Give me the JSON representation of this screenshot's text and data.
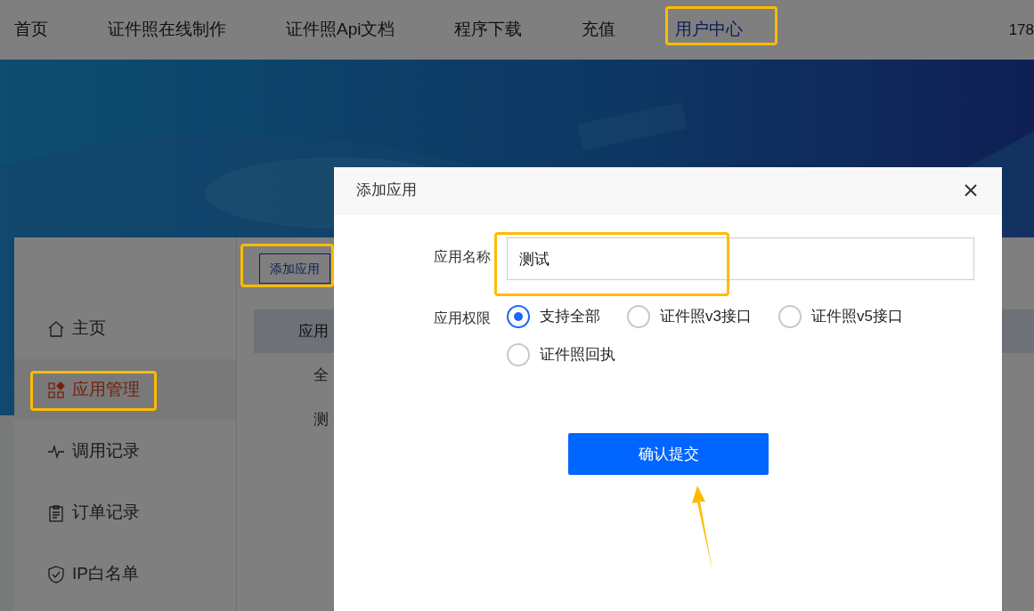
{
  "nav": {
    "items": [
      {
        "label": "首页",
        "selected": false
      },
      {
        "label": "证件照在线制作",
        "selected": false
      },
      {
        "label": "证件照Api文档",
        "selected": false
      },
      {
        "label": "程序下载",
        "selected": false
      },
      {
        "label": "充值",
        "selected": false
      },
      {
        "label": "用户中心",
        "selected": true
      }
    ],
    "user": "178"
  },
  "sidebar": {
    "items": [
      {
        "label": "主页",
        "selected": false
      },
      {
        "label": "应用管理",
        "selected": true
      },
      {
        "label": "调用记录",
        "selected": false
      },
      {
        "label": "订单记录",
        "selected": false
      },
      {
        "label": "IP白名单",
        "selected": false
      }
    ]
  },
  "content": {
    "add_button": "添加应用",
    "table": {
      "header": "应用",
      "rows": [
        "全",
        "测"
      ]
    }
  },
  "dialog": {
    "title": "添加应用",
    "name_label": "应用名称",
    "name_value": "测试",
    "permission_label": "应用权限",
    "options": [
      {
        "label": "支持全部",
        "selected": true
      },
      {
        "label": "证件照v3接口",
        "selected": false
      },
      {
        "label": "证件照v5接口",
        "selected": false
      },
      {
        "label": "证件照回执",
        "selected": false
      }
    ],
    "submit": "确认提交"
  }
}
